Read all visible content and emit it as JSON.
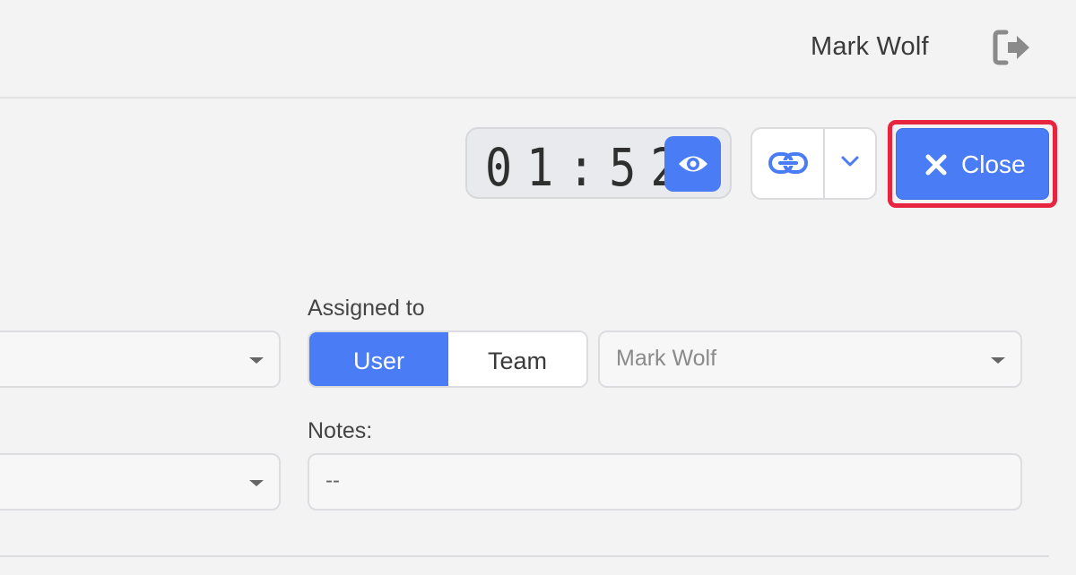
{
  "header": {
    "user_name": "Mark Wolf",
    "logout_icon": "sign-out-icon"
  },
  "toolbar": {
    "timer_value": "01:52",
    "eye_icon": "eye-icon",
    "link_icon": "link-icon",
    "dropdown_icon": "chevron-down-icon",
    "close_label": "Close",
    "close_icon": "close-icon"
  },
  "form": {
    "assigned_to_label": "Assigned to",
    "assign_type_options": [
      "User",
      "Team"
    ],
    "assign_type_selected": "User",
    "assignee_value": "Mark Wolf",
    "notes_label": "Notes:",
    "notes_value": "--",
    "left_select_1_value": "",
    "left_select_2_value": ""
  },
  "colors": {
    "accent": "#4a7cf6",
    "highlight": "#e8253f",
    "background": "#f3f3f4"
  }
}
